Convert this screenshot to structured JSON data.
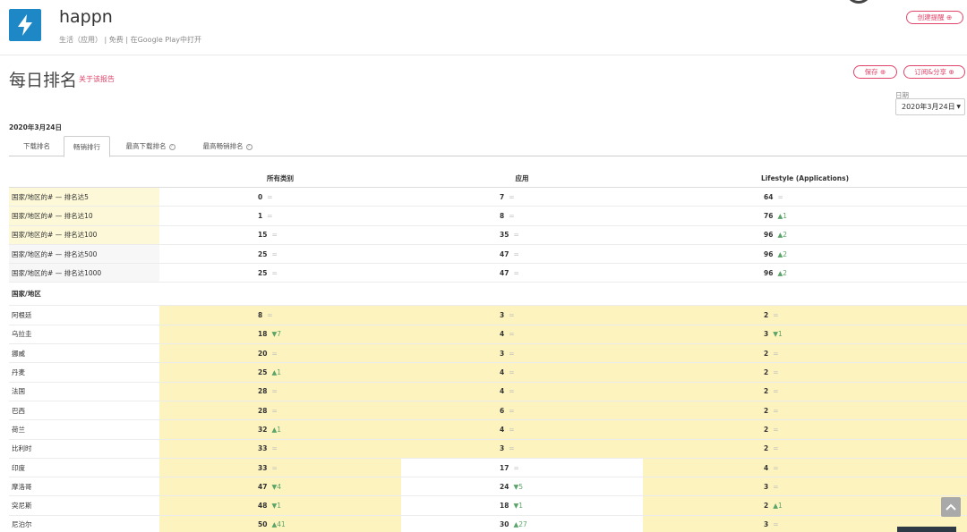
{
  "app": {
    "name": "happn",
    "meta": [
      "生活（应用）",
      "免费",
      "在Google Play中打开"
    ],
    "icon": "lightning-bolt-icon",
    "icon_color": "#1e88c7"
  },
  "actions": {
    "alert_label": "创建提醒",
    "save_label": "保存",
    "subscribe_label": "订阅&分享"
  },
  "page": {
    "title": "每日排名",
    "about_link": "关于该报告",
    "date_caption": "日期",
    "date_value": "2020年3月24日",
    "date_heading": "2020年3月24日"
  },
  "tabs": [
    {
      "label": "下载排名",
      "help": false
    },
    {
      "label": "畅销排行",
      "help": false,
      "active": true
    },
    {
      "label": "最高下载排名",
      "help": true
    },
    {
      "label": "最高畅销排名",
      "help": true
    }
  ],
  "table": {
    "columns": [
      "所有类别",
      "应用",
      "Lifestyle (Applications)"
    ],
    "summary_rows": [
      {
        "label": "国家/地区的# — 排名达5",
        "cells": [
          {
            "v": "0",
            "c": "="
          },
          {
            "v": "7",
            "c": "="
          },
          {
            "v": "64",
            "c": "="
          }
        ]
      },
      {
        "label": "国家/地区的# — 排名达10",
        "cells": [
          {
            "v": "1",
            "c": "="
          },
          {
            "v": "8",
            "c": "="
          },
          {
            "v": "76",
            "c": "▲1"
          }
        ]
      },
      {
        "label": "国家/地区的# — 排名达100",
        "cells": [
          {
            "v": "15",
            "c": "="
          },
          {
            "v": "35",
            "c": "="
          },
          {
            "v": "96",
            "c": "▲2"
          }
        ]
      },
      {
        "label": "国家/地区的# — 排名达500",
        "cells": [
          {
            "v": "25",
            "c": "="
          },
          {
            "v": "47",
            "c": "="
          },
          {
            "v": "96",
            "c": "▲2"
          }
        ]
      },
      {
        "label": "国家/地区的# — 排名达1000",
        "cells": [
          {
            "v": "25",
            "c": "="
          },
          {
            "v": "47",
            "c": "="
          },
          {
            "v": "96",
            "c": "▲2"
          }
        ]
      }
    ],
    "country_header": "国家/地区",
    "country_rows": [
      {
        "label": "阿根廷",
        "cells": [
          {
            "v": "8",
            "c": "="
          },
          {
            "v": "3",
            "c": "="
          },
          {
            "v": "2",
            "c": "="
          }
        ]
      },
      {
        "label": "乌拉圭",
        "cells": [
          {
            "v": "18",
            "c": "▼7"
          },
          {
            "v": "4",
            "c": "="
          },
          {
            "v": "3",
            "c": "▼1"
          }
        ]
      },
      {
        "label": "挪威",
        "cells": [
          {
            "v": "20",
            "c": "="
          },
          {
            "v": "3",
            "c": "="
          },
          {
            "v": "2",
            "c": "="
          }
        ]
      },
      {
        "label": "丹麦",
        "cells": [
          {
            "v": "25",
            "c": "▲1"
          },
          {
            "v": "4",
            "c": "="
          },
          {
            "v": "2",
            "c": "="
          }
        ]
      },
      {
        "label": "法国",
        "cells": [
          {
            "v": "28",
            "c": "="
          },
          {
            "v": "4",
            "c": "="
          },
          {
            "v": "2",
            "c": "="
          }
        ]
      },
      {
        "label": "巴西",
        "cells": [
          {
            "v": "28",
            "c": "="
          },
          {
            "v": "6",
            "c": "="
          },
          {
            "v": "2",
            "c": "="
          }
        ]
      },
      {
        "label": "荷兰",
        "cells": [
          {
            "v": "32",
            "c": "▲1"
          },
          {
            "v": "4",
            "c": "="
          },
          {
            "v": "2",
            "c": "="
          }
        ]
      },
      {
        "label": "比利时",
        "cells": [
          {
            "v": "33",
            "c": "="
          },
          {
            "v": "3",
            "c": "="
          },
          {
            "v": "2",
            "c": "="
          }
        ]
      },
      {
        "label": "印度",
        "cells": [
          {
            "v": "33",
            "c": "="
          },
          {
            "v": "17",
            "c": "="
          },
          {
            "v": "4",
            "c": "="
          }
        ]
      },
      {
        "label": "摩洛哥",
        "cells": [
          {
            "v": "47",
            "c": "▼4"
          },
          {
            "v": "24",
            "c": "▼5"
          },
          {
            "v": "3",
            "c": "="
          }
        ]
      },
      {
        "label": "突尼斯",
        "cells": [
          {
            "v": "48",
            "c": "▼1"
          },
          {
            "v": "18",
            "c": "▼1"
          },
          {
            "v": "2",
            "c": "▲1"
          }
        ]
      },
      {
        "label": "尼泊尔",
        "cells": [
          {
            "v": "50",
            "c": "▲41"
          },
          {
            "v": "30",
            "c": "▲27"
          },
          {
            "v": "3",
            "c": "="
          }
        ]
      }
    ]
  },
  "colors": {
    "accent": "#e0446a",
    "highlight": "#fdf3bf",
    "highlight_light": "#fdf9d8",
    "change": "#5aa469"
  }
}
